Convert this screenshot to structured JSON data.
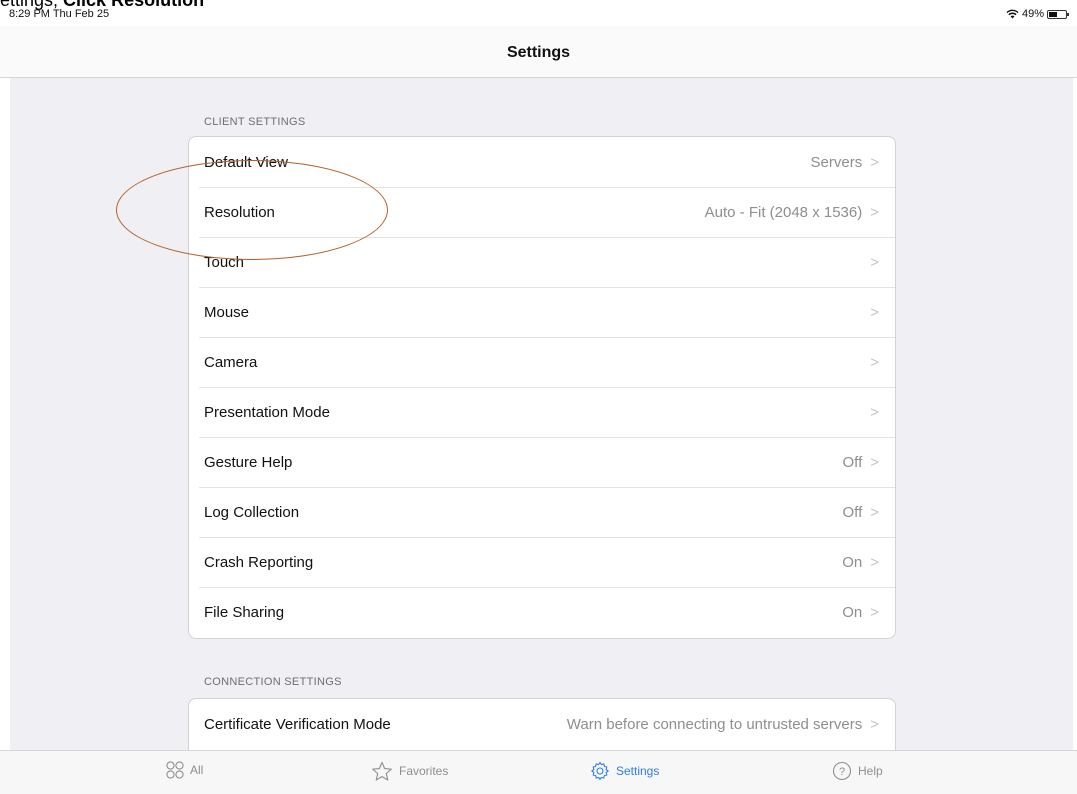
{
  "caption": {
    "prefix": "ettings; ",
    "bold": "Click Resolution"
  },
  "status": {
    "time": "8:29 PM  Thu Feb 25",
    "battery": "49%",
    "battery_level": 0.49
  },
  "nav": {
    "title": "Settings"
  },
  "client_settings": {
    "header": "CLIENT SETTINGS",
    "rows": [
      {
        "label": "Default View",
        "value": "Servers"
      },
      {
        "label": "Resolution",
        "value": "Auto - Fit (2048 x 1536)"
      },
      {
        "label": "Touch",
        "value": ""
      },
      {
        "label": "Mouse",
        "value": ""
      },
      {
        "label": "Camera",
        "value": ""
      },
      {
        "label": "Presentation Mode",
        "value": ""
      },
      {
        "label": "Gesture Help",
        "value": "Off"
      },
      {
        "label": "Log Collection",
        "value": "Off"
      },
      {
        "label": "Crash Reporting",
        "value": "On"
      },
      {
        "label": "File Sharing",
        "value": "On"
      }
    ]
  },
  "connection_settings": {
    "header": "CONNECTION SETTINGS",
    "rows": [
      {
        "label": "Certificate Verification Mode",
        "value": "Warn before connecting to untrusted servers"
      }
    ]
  },
  "chevron": ">",
  "tabs": [
    {
      "label": "All",
      "icon": "grid-icon"
    },
    {
      "label": "Favorites",
      "icon": "star-icon"
    },
    {
      "label": "Settings",
      "icon": "gear-icon"
    },
    {
      "label": "Help",
      "icon": "help-icon"
    }
  ],
  "colors": {
    "accent": "#2f7de1",
    "annotation": "#b5622a"
  }
}
